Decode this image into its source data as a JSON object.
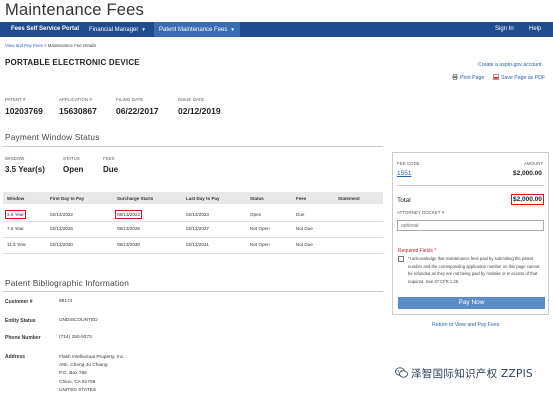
{
  "page_title": "Maintenance Fees",
  "nav": {
    "brand": "Fees Self Service Portal",
    "financial_manager": "Financial Manager",
    "patent_maintenance_fees": "Patent Maintenance Fees",
    "sign_in": "Sign In",
    "help": "Help"
  },
  "breadcrumb": {
    "link": "View and Pay Fees",
    "separator": ">",
    "current": "Maintenance Fee Details"
  },
  "heading": "PORTABLE ELECTRONIC DEVICE",
  "top_links": {
    "create_account": "Create a uspto.gov account.",
    "print_page": "Print Page",
    "save_pdf": "Save Page as PDF"
  },
  "patent_info": {
    "patent_label": "PATENT #",
    "patent_value": "10203769",
    "application_label": "APPLICATION #",
    "application_value": "15630867",
    "filing_label": "FILING DATE",
    "filing_value": "06/22/2017",
    "issue_label": "ISSUE DATE",
    "issue_value": "02/12/2019"
  },
  "payment_window": {
    "title": "Payment Window Status",
    "window_label": "WINDOW",
    "window_value": "3.5 Year(s)",
    "status_label": "STATUS",
    "status_value": "Open",
    "fees_label": "FEES",
    "fees_value": "Due"
  },
  "table": {
    "headers": [
      "Window",
      "First Day to Pay",
      "Surcharge Starts",
      "Last Day to Pay",
      "Status",
      "Fees",
      "Statement"
    ],
    "rows": [
      [
        "3.5 Year",
        "02/12/2022",
        "08/13/2022",
        "02/13/2023",
        "Open",
        "Due",
        ""
      ],
      [
        "7.5 Year",
        "02/12/2026",
        "08/13/2026",
        "02/12/2027",
        "Not Open",
        "Not Due",
        ""
      ],
      [
        "11.5 Year",
        "02/12/2030",
        "08/13/2030",
        "02/12/2031",
        "Not Open",
        "Not Due",
        ""
      ]
    ]
  },
  "fee_panel": {
    "fee_code_label": "FEE CODE",
    "amount_label": "AMOUNT",
    "fee_code": "1551",
    "amount": "$2,000.00",
    "total_label": "Total",
    "total_value": "$2,000.00",
    "attorney_label": "ATTORNEY DOCKET #",
    "attorney_placeholder": "optional",
    "required_label": "Required Fields *",
    "ack_text": "*I acknowledge that maintenance fees paid by submitting the patent number and the corresponding application number on this page cannot be refunded as they are not being paid by mistake or in excess of that required. See 37 CFR 1.26.",
    "pay_now": "Pay Now",
    "return_link": "Return to View and Pay Fees"
  },
  "bibliographic": {
    "title": "Patent Bibliographic Information",
    "customer_label": "Customer #",
    "customer_value": "88174",
    "entity_label": "Entity Status",
    "entity_value": "UNDISCOUNTED",
    "phone_label": "Phone Number",
    "phone_value": "(714) 350-9373",
    "address_label": "Address",
    "address_lines": [
      "Flash Intellectual Property, Inc.",
      "Attn. Cheng-Ju Chiang",
      "P.O. Box 766",
      "Chino, CA 91708",
      "UNITED STATES"
    ]
  },
  "watermark": "泽智国际知识产权 ZZPIS",
  "colors": {
    "nav_bg": "#1f4c8f",
    "nav_active": "#3a6cb3",
    "link": "#2a5db0",
    "pay_button": "#5a8cc7",
    "highlight": "#dd1111"
  }
}
